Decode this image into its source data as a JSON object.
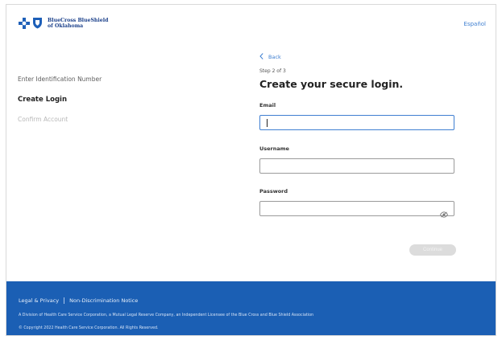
{
  "header": {
    "logo_line1": "BlueCross BlueShield",
    "logo_line2": "of Oklahoma",
    "language_link": "Español"
  },
  "steps": [
    {
      "label": "Enter Identification Number",
      "state": "done"
    },
    {
      "label": "Create Login",
      "state": "active"
    },
    {
      "label": "Confirm Account",
      "state": "pending"
    }
  ],
  "form": {
    "back_label": "Back",
    "step_indicator": "Step 2 of 3",
    "title": "Create your secure login.",
    "email_label": "Email",
    "email_value": "",
    "username_label": "Username",
    "username_value": "",
    "password_label": "Password",
    "password_value": "",
    "submit_label": "Continue"
  },
  "footer": {
    "links": [
      "Legal & Privacy",
      "Non-Discrimination Notice"
    ],
    "disclaimer": "A Division of Health Care Service Corporation, a Mutual Legal Reserve Company, an Independent Licensee of the Blue Cross and Blue Shield Association",
    "copyright": "© Copyright 2022 Health Care Service Corporation. All Rights Reserved."
  },
  "colors": {
    "brand_blue": "#1b5fb4",
    "link_blue": "#3f7fd1",
    "button_disabled": "#dcdcdc"
  },
  "icons": [
    "bluecross-logo-icon",
    "blueshield-logo-icon",
    "chevron-left-icon",
    "eye-icon"
  ]
}
